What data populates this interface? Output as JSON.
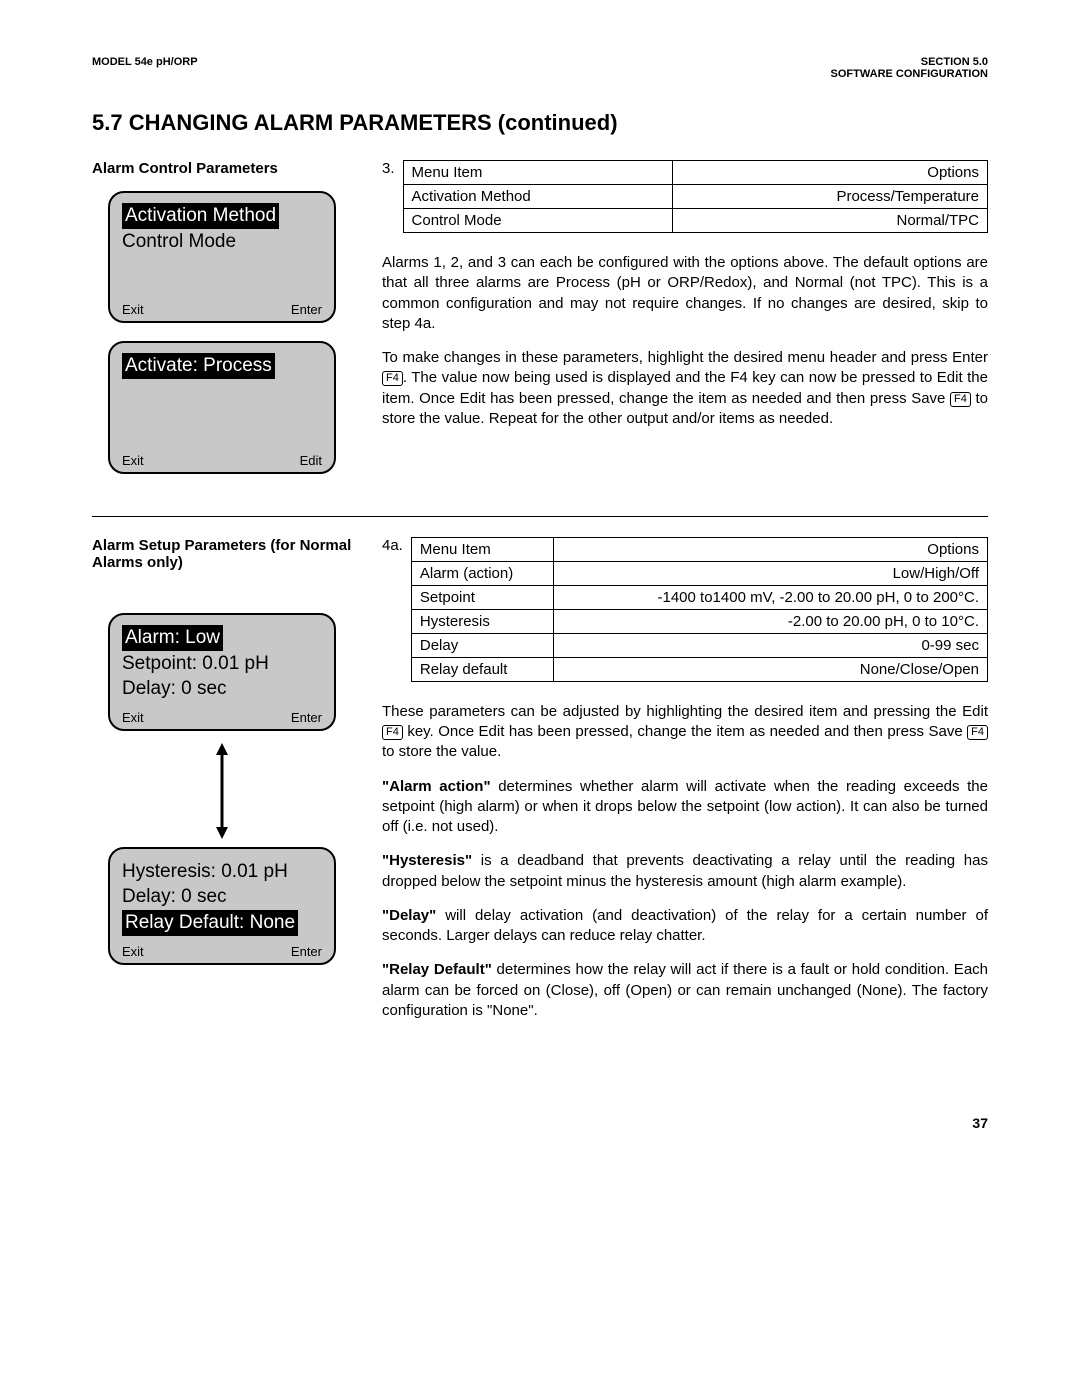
{
  "header": {
    "left": "MODEL 54e pH/ORP",
    "right1": "SECTION 5.0",
    "right2": "SOFTWARE CONFIGURATION"
  },
  "title": "5.7 CHANGING ALARM PARAMETERS (continued)",
  "section1": {
    "subhead": "Alarm Control Parameters",
    "step": "3.",
    "table": {
      "h1": "Menu Item",
      "h2": "Options",
      "r1c1": "Activation Method",
      "r1c2": "Process/Temperature",
      "r2c1": "Control Mode",
      "r2c2": "Normal/TPC"
    },
    "lcd1": {
      "line1": "Activation Method",
      "line2": "Control Mode",
      "foot_left": "Exit",
      "foot_right": "Enter"
    },
    "lcd2": {
      "line1": "Activate: Process",
      "foot_left": "Exit",
      "foot_right": "Edit"
    },
    "para1": "Alarms 1, 2, and 3 can each be configured with the options above. The default options are that all three alarms are Process (pH or ORP/Redox), and  Normal (not TPC).  This is a common configuration and may not require changes.  If no changes are desired, skip to step 4a.",
    "para2a": "To make changes in these parameters, highlight the desired menu header and press Enter ",
    "para2b": ". The value now being used is displayed and the F4 key can now be pressed to Edit the item. Once Edit has been pressed, change the item as needed and then press Save ",
    "para2c": " to store the value. Repeat for the other output and/or items as needed.",
    "key": "F4"
  },
  "section2": {
    "subhead": "Alarm Setup Parameters (for Normal Alarms only)",
    "step": "4a.",
    "table": {
      "h1": "Menu Item",
      "h2": "Options",
      "r1c1": "Alarm (action)",
      "r1c2": "Low/High/Off",
      "r2c1": "Setpoint",
      "r2c2": "-1400 to1400 mV, -2.00 to 20.00 pH, 0 to 200°C.",
      "r3c1": "Hysteresis",
      "r3c2": "-2.00 to 20.00 pH, 0 to 10°C.",
      "r4c1": "Delay",
      "r4c2": "0-99 sec",
      "r5c1": "Relay default",
      "r5c2": "None/Close/Open"
    },
    "lcd3": {
      "line1": "Alarm: Low",
      "line2": "Setpoint: 0.01 pH",
      "line3": "Delay: 0 sec",
      "foot_left": "Exit",
      "foot_right": "Enter"
    },
    "lcd4": {
      "line1": "Hysteresis: 0.01 pH",
      "line2": "Delay: 0 sec",
      "line3": "Relay Default: None",
      "foot_left": "Exit",
      "foot_right": "Enter"
    },
    "para1a": "These parameters can be adjusted by highlighting the desired item and pressing the Edit ",
    "para1b": " key.  Once Edit has been pressed, change the item as needed and then press Save ",
    "para1c": " to store the value.",
    "para2_lead": "\"Alarm action\"",
    "para2_rest": " determines whether alarm will activate when the reading exceeds the setpoint (high alarm) or when it drops below the setpoint (low action).  It can also be turned off (i.e. not used).",
    "para3_lead": "\"Hysteresis\"",
    "para3_rest": " is a deadband that prevents deactivating a relay until the reading has dropped below the setpoint minus the hysteresis amount (high alarm example).",
    "para4_lead": "\"Delay\"",
    "para4_rest": " will delay activation (and deactivation) of the relay for a certain number of seconds. Larger delays can reduce relay chatter.",
    "para5_lead": "\"Relay Default\"",
    "para5_rest": " determines how the relay will act if there is a fault or hold condition.  Each alarm can be forced on (Close), off (Open) or can remain unchanged (None).  The factory configuration is \"None\".",
    "key": "F4"
  },
  "page_number": "37"
}
